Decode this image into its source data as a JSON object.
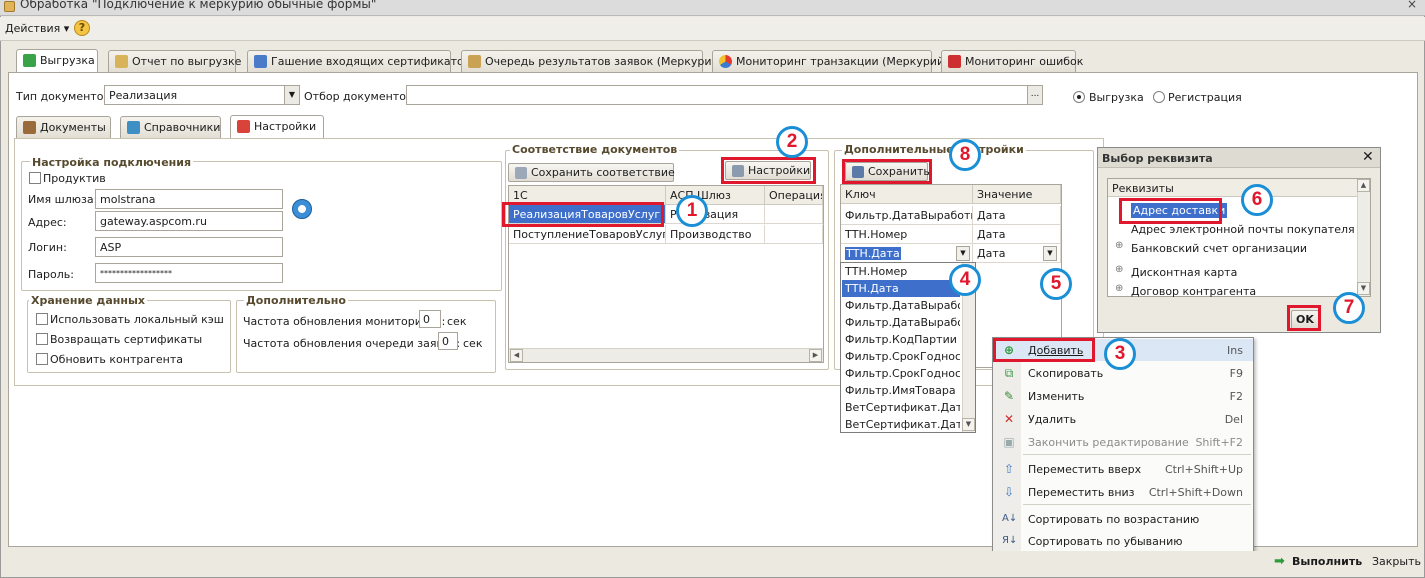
{
  "window": {
    "title": "Обработка \"Подключение к меркурию обычные формы\"",
    "close_glyph": "×"
  },
  "menu": {
    "actions": "Действия",
    "help": "?"
  },
  "top_tabs": [
    {
      "label": "Выгрузка",
      "active": true
    },
    {
      "label": "Отчет по выгрузке"
    },
    {
      "label": "Гашение входящих сертификатов"
    },
    {
      "label": "Очередь результатов заявок (Меркурий)"
    },
    {
      "label": "Мониторинг транзакции (Меркурий)"
    },
    {
      "label": "Мониторинг ошибок"
    }
  ],
  "filters": {
    "doc_type_label": "Тип документов:",
    "doc_type_value": "Реализация",
    "doc_filter_label": "Отбор документов:",
    "doc_filter_value": "",
    "ellipsis": "...",
    "radio_upload": "Выгрузка",
    "radio_register": "Регистрация",
    "selected": "upload"
  },
  "sub_tabs": [
    {
      "label": "Документы"
    },
    {
      "label": "Справочники"
    },
    {
      "label": "Настройки",
      "active": true
    }
  ],
  "connection": {
    "title": "Настройка подключения",
    "production_label": "Продуктив",
    "gateway_label": "Имя шлюза:",
    "gateway_value": "molstrana",
    "address_label": "Адрес:",
    "address_value": "gateway.aspcom.ru",
    "login_label": "Логин:",
    "login_value": "ASP",
    "password_label": "Пароль:",
    "password_value": "******************"
  },
  "storage": {
    "title": "Хранение данных",
    "use_cache": "Использовать локальный кэш",
    "return_certs": "Возвращать сертификаты",
    "update_contractor": "Обновить контрагента"
  },
  "extra": {
    "title": "Дополнительно",
    "monitor_label": "Частота обновления мониторинга:",
    "monitor_value": "0",
    "queue_label": "Частота обновления очереди заявок:",
    "queue_value": "0",
    "unit": "сек"
  },
  "doc_match": {
    "title": "Соответствие документов",
    "save_button": "Сохранить соответствие",
    "settings_button": "Настройки",
    "columns": [
      "1С",
      "АСП Шлюз",
      "Операция"
    ],
    "rows": [
      [
        "РеализацияТоваровУслуг",
        "Реализация",
        ""
      ],
      [
        "ПоступлениеТоваровУслуг",
        "Производство",
        ""
      ]
    ]
  },
  "extra_settings": {
    "title": "Дополнительные настройки",
    "save_button": "Сохранить",
    "columns": [
      "Ключ",
      "Значение"
    ],
    "rows": [
      [
        "Фильтр.ДатаВыработки",
        "Дата"
      ],
      [
        "ТТН.Номер",
        "Дата"
      ],
      [
        "ТТН.Дата",
        "Дата"
      ]
    ],
    "dropdown": [
      "ТТН.Номер",
      "ТТН.Дата",
      "Фильтр.ДатаВыработки",
      "Фильтр.ДатаВыработки",
      "Фильтр.КодПартии",
      "Фильтр.СрокГодности",
      "Фильтр.СрокГодности",
      "Фильтр.ИмяТовара",
      "ВетСертификат.ДатаВыдачи",
      "ВетСертификат.ДатаВыдачи"
    ]
  },
  "context_menu": [
    {
      "label": "Добавить",
      "shortcut": "Ins",
      "icon": "add-icon"
    },
    {
      "label": "Скопировать",
      "shortcut": "F9",
      "icon": "copy-icon"
    },
    {
      "label": "Изменить",
      "shortcut": "F2",
      "icon": "edit-icon"
    },
    {
      "label": "Удалить",
      "shortcut": "Del",
      "icon": "delete-icon"
    },
    {
      "label": "Закончить редактирование",
      "shortcut": "Shift+F2",
      "icon": "finish-icon",
      "disabled": true
    },
    {
      "label": "Переместить вверх",
      "shortcut": "Ctrl+Shift+Up",
      "icon": "arrow-up-icon"
    },
    {
      "label": "Переместить вниз",
      "shortcut": "Ctrl+Shift+Down",
      "icon": "arrow-down-icon"
    },
    {
      "label": "Сортировать по возрастанию",
      "shortcut": "",
      "icon": "sort-asc-icon"
    },
    {
      "label": "Сортировать по убыванию",
      "shortcut": "",
      "icon": "sort-desc-icon"
    }
  ],
  "picker": {
    "title": "Выбор реквизита",
    "header": "Реквизиты",
    "items": [
      "Адрес доставки",
      "Адрес электронной почты покупателя",
      "Банковский счет организации",
      "Дисконтная карта",
      "Договор контрагента"
    ],
    "ok_button": "OK"
  },
  "footer": {
    "run": "Выполнить",
    "close": "Закрыть"
  },
  "markers": [
    "1",
    "2",
    "3",
    "4",
    "5",
    "6",
    "7",
    "8"
  ],
  "colors": {
    "highlight": "#e0182d",
    "marker_ring": "#1a8fd6",
    "selection": "#3d6fcb"
  }
}
